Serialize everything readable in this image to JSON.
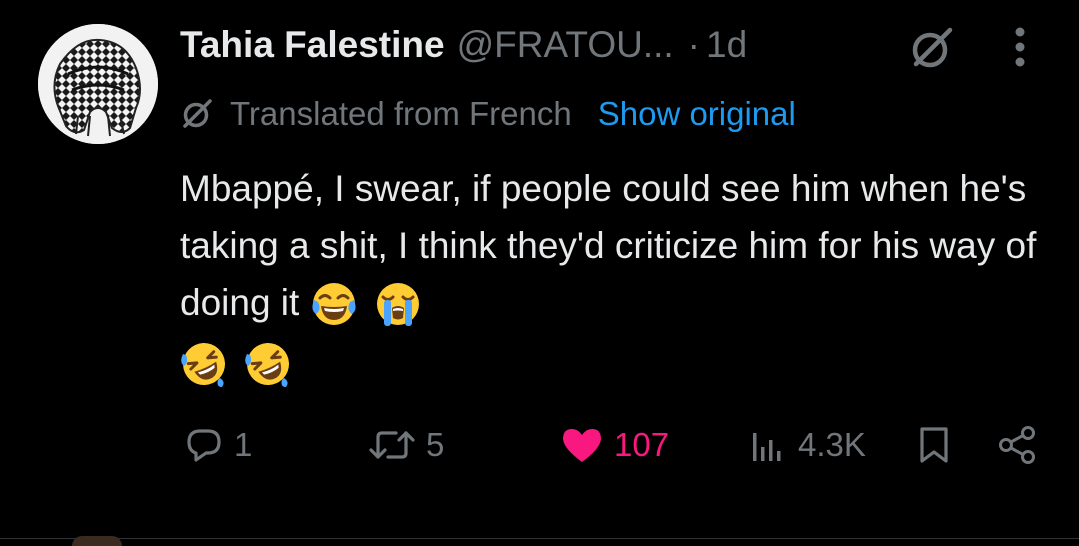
{
  "tweet": {
    "display_name": "Tahia Falestine",
    "handle": "@FRATOU...",
    "separator": "·",
    "age": "1d",
    "translation": {
      "label": "Translated from French",
      "show_original": "Show original"
    },
    "text": "Mbappé, I swear, if people could see him when he's taking a shit, I think they'd criticize him for his way of doing it",
    "emojis_inline": [
      "face-with-tears-of-joy",
      "loudly-crying-face"
    ],
    "emojis_next_line": [
      "rolling-on-the-floor-laughing",
      "rolling-on-the-floor-laughing"
    ],
    "actions": {
      "replies": "1",
      "reposts": "5",
      "likes": "107",
      "views": "4.3K"
    }
  },
  "colors": {
    "background": "#000000",
    "primary_text": "#e7e9ea",
    "secondary_text": "#71767b",
    "link": "#1d9bf0",
    "like": "#f91880"
  },
  "icons": {
    "header": [
      "grok-icon",
      "more-dots-icon"
    ],
    "translation": "grok-icon",
    "actions": [
      "reply-icon",
      "repost-icon",
      "heart-icon",
      "views-icon",
      "bookmark-icon",
      "share-icon"
    ]
  }
}
